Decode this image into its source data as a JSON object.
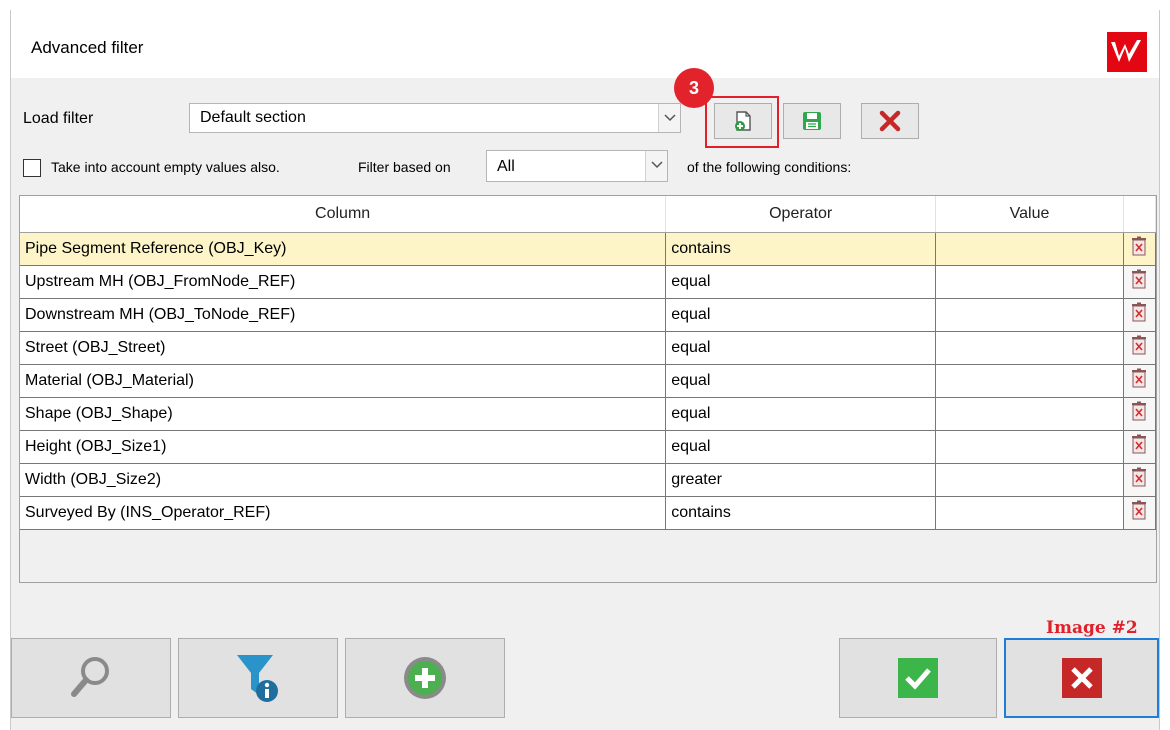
{
  "window": {
    "title": "Advanced filter"
  },
  "load_filter": {
    "label": "Load filter",
    "selected": "Default section"
  },
  "toolbar": {
    "new_icon": "new-document-icon",
    "save_icon": "save-icon",
    "delete_icon": "delete-x-icon",
    "badge": "3"
  },
  "options": {
    "empty_values_label": "Take into account empty values also.",
    "empty_values_checked": false,
    "filter_based_on_label": "Filter based on",
    "filter_based_on_value": "All",
    "conditions_suffix": "of the following conditions:"
  },
  "grid": {
    "headers": [
      "Column",
      "Operator",
      "Value"
    ],
    "rows": [
      {
        "column": "Pipe Segment Reference (OBJ_Key)",
        "operator": "contains",
        "value": ""
      },
      {
        "column": "Upstream MH (OBJ_FromNode_REF)",
        "operator": "equal",
        "value": ""
      },
      {
        "column": "Downstream MH (OBJ_ToNode_REF)",
        "operator": "equal",
        "value": ""
      },
      {
        "column": "Street (OBJ_Street)",
        "operator": "equal",
        "value": ""
      },
      {
        "column": "Material (OBJ_Material)",
        "operator": "equal",
        "value": ""
      },
      {
        "column": "Shape (OBJ_Shape)",
        "operator": "equal",
        "value": ""
      },
      {
        "column": "Height (OBJ_Size1)",
        "operator": "equal",
        "value": ""
      },
      {
        "column": "Width (OBJ_Size2)",
        "operator": "greater",
        "value": ""
      },
      {
        "column": "Surveyed By (INS_Operator_REF)",
        "operator": "contains",
        "value": ""
      }
    ]
  },
  "bottom": {
    "image_label": "Image #2",
    "buttons": [
      "search-icon",
      "filter-info-icon",
      "add-icon",
      "ok-check-icon",
      "cancel-x-icon"
    ]
  },
  "colors": {
    "accent_red": "#e3232c",
    "selected_row": "#fdf5c8",
    "ok_green": "#3cb54a",
    "cancel_red": "#c62828",
    "focus_blue": "#1e7fd6"
  }
}
